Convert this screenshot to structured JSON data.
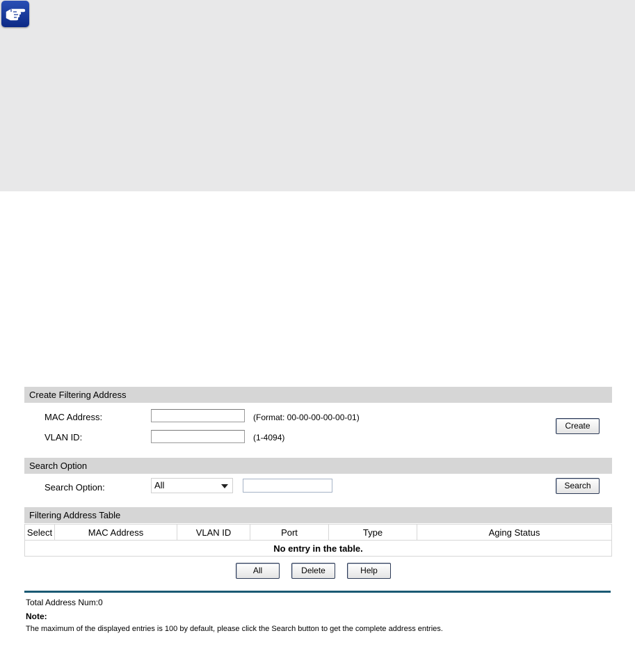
{
  "create_section": {
    "title": "Create Filtering Address",
    "mac_label": "MAC Address:",
    "mac_value": "",
    "mac_hint": "(Format: 00-00-00-00-00-01)",
    "vlan_label": "VLAN ID:",
    "vlan_value": "",
    "vlan_hint": "(1-4094)",
    "create_button": "Create"
  },
  "search_section": {
    "title": "Search Option",
    "label": "Search Option:",
    "selected": "All",
    "value": "",
    "search_button": "Search"
  },
  "table_section": {
    "title": "Filtering Address Table",
    "columns": [
      "Select",
      "MAC Address",
      "VLAN ID",
      "Port",
      "Type",
      "Aging Status"
    ],
    "empty_message": "No entry in the table."
  },
  "actions": {
    "all": "All",
    "delete": "Delete",
    "help": "Help"
  },
  "footer": {
    "total": "Total Address Num:0",
    "note_title": "Note:",
    "note_text": "The maximum of the displayed entries is 100 by default, please click the Search button to get the complete address entries."
  },
  "icons": {
    "note": "pointing-hand-icon"
  },
  "colors": {
    "note_background": "#e8e8e9",
    "section_bar": "#d6d6d6",
    "divider": "#1b5a74",
    "icon_badge": "#1a3d9e"
  }
}
